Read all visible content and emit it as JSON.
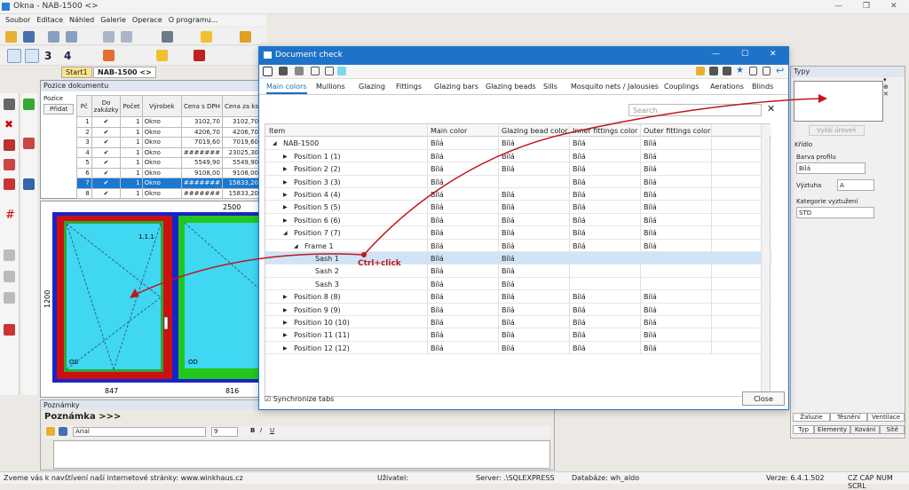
{
  "window": {
    "title": "Okna - NAB-1500 <>"
  },
  "menu": [
    "Soubor",
    "Editace",
    "Náhled",
    "Galerie",
    "Operace",
    "O programu..."
  ],
  "toolbar2": {
    "n3": "3",
    "n4": "4"
  },
  "doc_tabs": [
    "Start1",
    "NAB-1500 <>"
  ],
  "poz": {
    "title": "Pozice dokumentu",
    "pozice": "Pozice",
    "pridat": "Přidat",
    "cols": [
      "Pč",
      "Do zakázky",
      "Počet",
      "Výrobek",
      "Cena s DPH",
      "Cena za ks"
    ],
    "rows": [
      [
        "1",
        "✔",
        "1",
        "Okno",
        "3102,70",
        "3102,70"
      ],
      [
        "2",
        "✔",
        "1",
        "Okno",
        "4206,70",
        "4206,70"
      ],
      [
        "3",
        "✔",
        "1",
        "Okno",
        "7019,60",
        "7019,60"
      ],
      [
        "4",
        "✔",
        "1",
        "Okno",
        "#######",
        "23025,30"
      ],
      [
        "5",
        "✔",
        "1",
        "Okno",
        "5549,90",
        "5549,90"
      ],
      [
        "6",
        "✔",
        "1",
        "Okno",
        "9108,00",
        "9108,00"
      ],
      [
        "7",
        "✔",
        "1",
        "Okno",
        "#######",
        "15833,20"
      ],
      [
        "8",
        "✔",
        "1",
        "Okno",
        "#######",
        "15833,20"
      ]
    ]
  },
  "drawing": {
    "width": "2500",
    "height": "1200",
    "w1": "847",
    "w2": "816",
    "label1": "1.1.1",
    "os": "OS",
    "od": "OD"
  },
  "notes": {
    "title": "Poznámky",
    "tab": "Poznámka",
    "more": ">>>",
    "font": "Arial",
    "size": "9",
    "b": "B",
    "i": "I",
    "u": "U"
  },
  "status": {
    "msg": "Zveme vás k navštívení naší internetové stránky: www.winkhaus.cz",
    "user": "Uživatel:",
    "server": "Server: .\\SQLEXPRESS",
    "db": "Databáze: wh_aldo",
    "ver": "Verze: 6.4.1.502",
    "keys": "CZ CAP NUM SCRL"
  },
  "dialog": {
    "title": "Document check",
    "tabs": [
      "Main colors",
      "Mullions",
      "Glazing",
      "Fittings",
      "Glazing bars",
      "Glazing beads",
      "Sills",
      "Mosquito nets / Jalousies",
      "Couplings",
      "Aerations",
      "Blinds"
    ],
    "search": "Search",
    "cols": [
      "Item",
      "Main color",
      "Glazing bead color",
      "Inner fittings color",
      "Outer fittings color"
    ],
    "rows": [
      {
        "exp": "◢",
        "label": "NAB-1500",
        "c": [
          "Bílá",
          "Bílá",
          "Bílá",
          "Bílá"
        ],
        "lvl": 0
      },
      {
        "exp": "▶",
        "label": "Position 1 (1)",
        "c": [
          "Bílá",
          "Bílá",
          "Bílá",
          "Bílá"
        ],
        "lvl": 1
      },
      {
        "exp": "▶",
        "label": "Position 2 (2)",
        "c": [
          "Bílá",
          "Bílá",
          "Bílá",
          "Bílá"
        ],
        "lvl": 1
      },
      {
        "exp": "▶",
        "label": "Position 3 (3)",
        "c": [
          "Bílá",
          "",
          "Bílá",
          "Bílá"
        ],
        "lvl": 1
      },
      {
        "exp": "▶",
        "label": "Position 4 (4)",
        "c": [
          "Bílá",
          "Bílá",
          "Bílá",
          "Bílá"
        ],
        "lvl": 1
      },
      {
        "exp": "▶",
        "label": "Position 5 (5)",
        "c": [
          "Bílá",
          "Bílá",
          "Bílá",
          "Bílá"
        ],
        "lvl": 1
      },
      {
        "exp": "▶",
        "label": "Position 6 (6)",
        "c": [
          "Bílá",
          "Bílá",
          "Bílá",
          "Bílá"
        ],
        "lvl": 1
      },
      {
        "exp": "◢",
        "label": "Position 7 (7)",
        "c": [
          "Bílá",
          "Bílá",
          "Bílá",
          "Bílá"
        ],
        "lvl": 1
      },
      {
        "exp": "◢",
        "label": "Frame 1",
        "c": [
          "Bílá",
          "Bílá",
          "Bílá",
          "Bílá"
        ],
        "lvl": 2
      },
      {
        "exp": "",
        "label": "Sash 1",
        "c": [
          "Bílá",
          "Bílá",
          "",
          ""
        ],
        "lvl": 3,
        "sel": true
      },
      {
        "exp": "",
        "label": "Sash 2",
        "c": [
          "Bílá",
          "Bílá",
          "",
          ""
        ],
        "lvl": 3
      },
      {
        "exp": "",
        "label": "Sash 3",
        "c": [
          "Bílá",
          "Bílá",
          "",
          ""
        ],
        "lvl": 3
      },
      {
        "exp": "▶",
        "label": "Position 8 (8)",
        "c": [
          "Bílá",
          "Bílá",
          "Bílá",
          "Bílá"
        ],
        "lvl": 1
      },
      {
        "exp": "▶",
        "label": "Position 9 (9)",
        "c": [
          "Bílá",
          "Bílá",
          "Bílá",
          "Bílá"
        ],
        "lvl": 1
      },
      {
        "exp": "▶",
        "label": "Position 10 (10)",
        "c": [
          "Bílá",
          "Bílá",
          "Bílá",
          "Bílá"
        ],
        "lvl": 1
      },
      {
        "exp": "▶",
        "label": "Position 11 (11)",
        "c": [
          "Bílá",
          "Bílá",
          "Bílá",
          "Bílá"
        ],
        "lvl": 1
      },
      {
        "exp": "▶",
        "label": "Position 12 (12)",
        "c": [
          "Bílá",
          "Bílá",
          "Bílá",
          "Bílá"
        ],
        "lvl": 1
      }
    ],
    "sync": "Synchronize tabs",
    "close": "Close",
    "annotation": "Ctrl+click"
  },
  "right": {
    "title": "Typy",
    "btn": "Vyšší úroveň",
    "sec": "Křídlo",
    "barva": "Barva profilu",
    "barva_val": "Bílá",
    "vyztuha": "Výztuha",
    "vyztuha_val": "A",
    "kat": "Kategorie vyztužení",
    "kat_val": "STD",
    "tabs1": [
      "Žaluzie",
      "Těsnění",
      "Ventilace"
    ],
    "tabs2": [
      "Typ",
      "Elementy",
      "Kování",
      "Sítě"
    ]
  },
  "colors": {
    "accent": "#1e73c9",
    "frame_red": "#cc1010",
    "glass": "#3fd7f2",
    "frame_green": "#22c71e",
    "arrow": "#c0171b"
  }
}
